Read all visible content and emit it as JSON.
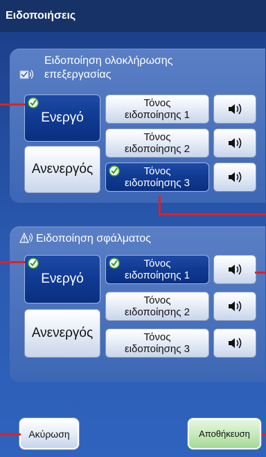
{
  "title": "Ειδοποιήσεις",
  "completion_section": {
    "heading": [
      "Ειδοποίηση ολοκλήρωσης",
      "επεξεργασίας"
    ],
    "icon": "message-speaker-icon",
    "states": [
      {
        "label": "Ενεργό",
        "selected": true
      },
      {
        "label": "Ανενεργός",
        "selected": false
      }
    ],
    "tones": [
      {
        "line1": "Τόνος",
        "line2": "ειδοποίησης 1",
        "selected": false
      },
      {
        "line1": "Τόνος",
        "line2": "ειδοποίησης 2",
        "selected": false
      },
      {
        "line1": "Τόνος",
        "line2": "ειδοποίησης 3",
        "selected": true
      }
    ]
  },
  "error_section": {
    "heading": "Ειδοποίηση σφάλματος",
    "icon": "warning-speaker-icon",
    "states": [
      {
        "label": "Ενεργό",
        "selected": true
      },
      {
        "label": "Ανενεργός",
        "selected": false
      }
    ],
    "tones": [
      {
        "line1": "Τόνος",
        "line2": "ειδοποίησης 1",
        "selected": true
      },
      {
        "line1": "Τόνος",
        "line2": "ειδοποίησης 2",
        "selected": false
      },
      {
        "line1": "Τόνος",
        "line2": "ειδοποίησης 3",
        "selected": false
      }
    ]
  },
  "footer": {
    "cancel_label": "Ακύρωση",
    "save_label": "Αποθήκευση"
  },
  "colors": {
    "title_bar": "#173267",
    "active_button": "#0f3a92",
    "check_green": "#4caf2b",
    "annotation_marker": "#e51f1f"
  }
}
